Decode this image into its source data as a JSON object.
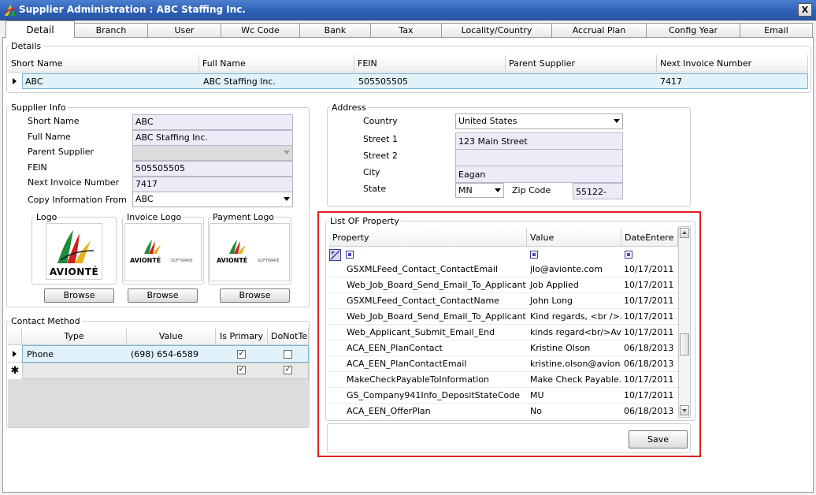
{
  "window": {
    "title": "Supplier Administration : ABC Staffing Inc.",
    "close_glyph": "X"
  },
  "tabs": [
    "Detail",
    "Branch",
    "User",
    "Wc Code",
    "Bank",
    "Tax",
    "Locality/Country",
    "Accrual Plan",
    "Config Year",
    "Email"
  ],
  "details": {
    "legend": "Details",
    "columns": [
      "Short Name",
      "Full Name",
      "FEIN",
      "Parent Supplier",
      "Next Invoice Number"
    ],
    "row": [
      "ABC",
      "ABC Staffing Inc.",
      "505505505",
      "",
      "7417"
    ]
  },
  "supplier_info": {
    "legend": "Supplier Info",
    "labels": [
      "Short Name",
      "Full Name",
      "Parent Supplier",
      "FEIN",
      "Next Invoice Number",
      "Copy Information From"
    ],
    "values": {
      "short_name": "ABC",
      "full_name": "ABC Staffing Inc.",
      "parent_supplier": "",
      "fein": "505505505",
      "next_invoice": "7417",
      "copy_from": "ABC"
    },
    "logos": [
      {
        "legend": "Logo",
        "brand": "AVIONTÉ",
        "browse": "Browse"
      },
      {
        "legend": "Invoice Logo",
        "brand": "AVIONTÉ",
        "sub": "SOFTWARE",
        "browse": "Browse"
      },
      {
        "legend": "Payment Logo",
        "brand": "AVIONTÉ",
        "sub": "SOFTWARE",
        "browse": "Browse"
      }
    ]
  },
  "address": {
    "legend": "Address",
    "labels": {
      "country": "Country",
      "street1": "Street 1",
      "street2": "Street 2",
      "city": "City",
      "state": "State",
      "zip": "Zip Code"
    },
    "values": {
      "country": "United States",
      "street1": "123 Main Street",
      "street2": "",
      "city": "Eagan",
      "state": "MN",
      "zip": "55122-"
    }
  },
  "contact_method": {
    "legend": "Contact Method",
    "columns": [
      "Type",
      "Value",
      "Is Primary",
      "DoNotTe"
    ],
    "rows": [
      {
        "type": "Phone",
        "value": "(698) 654-6589",
        "is_primary": true,
        "do_not": false
      }
    ],
    "new_row_glyph": "✱"
  },
  "properties": {
    "legend": "List OF Property",
    "columns": [
      "Property",
      "Value",
      "DateEntere"
    ],
    "rows": [
      [
        "GSXMLFeed_Contact_ContactEmail",
        "jlo@avionte.com",
        "10/17/2011"
      ],
      [
        "Web_Job_Board_Send_Email_To_Applicant_...",
        "Job Applied",
        "10/17/2011"
      ],
      [
        "GSXMLFeed_Contact_ContactName",
        "John Long",
        "10/17/2011"
      ],
      [
        "Web_Job_Board_Send_Email_To_Applicant_...",
        "Kind regards, <br />...",
        "10/17/2011"
      ],
      [
        "Web_Applicant_Submit_Email_End",
        "kinds regard<br/>Av...",
        "10/17/2011"
      ],
      [
        "ACA_EEN_PlanContact",
        "Kristine Olson",
        "06/18/2013"
      ],
      [
        "ACA_EEN_PlanContactEmail",
        "kristine.olson@avion...",
        "06/18/2013"
      ],
      [
        "MakeCheckPayableToInformation",
        "Make Check Payable...",
        "10/17/2011"
      ],
      [
        "GS_Company941Info_DepositStateCode",
        "MU",
        "10/17/2011"
      ],
      [
        "ACA_EEN_OfferPlan",
        "No",
        "06/18/2013"
      ]
    ],
    "save_label": "Save"
  },
  "colors": {
    "title_bar": "#2c5eb3",
    "highlight": "#e02020",
    "selection": "#e1f2fb"
  }
}
